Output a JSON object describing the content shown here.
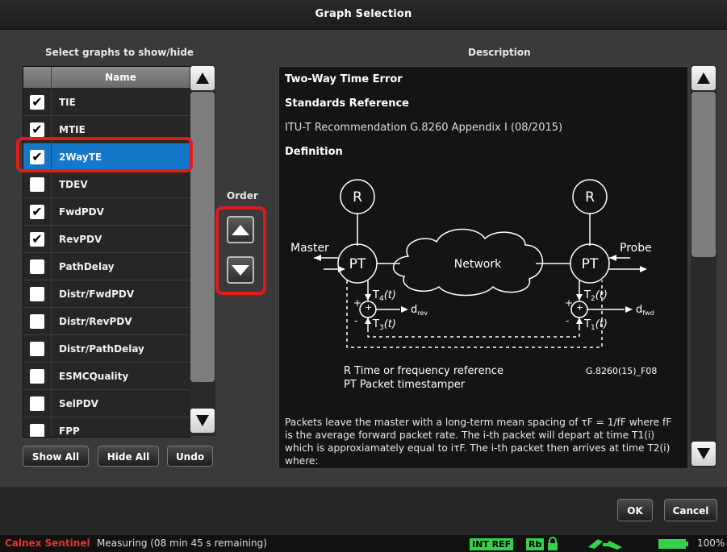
{
  "window": {
    "title": "Graph Selection"
  },
  "left_panel": {
    "title": "Select graphs to show/hide",
    "column_header": "Name",
    "items": [
      {
        "label": "TIE",
        "checked": true,
        "selected": false
      },
      {
        "label": "MTIE",
        "checked": true,
        "selected": false
      },
      {
        "label": "2WayTE",
        "checked": true,
        "selected": true
      },
      {
        "label": "TDEV",
        "checked": false,
        "selected": false
      },
      {
        "label": "FwdPDV",
        "checked": true,
        "selected": false
      },
      {
        "label": "RevPDV",
        "checked": true,
        "selected": false
      },
      {
        "label": "PathDelay",
        "checked": false,
        "selected": false
      },
      {
        "label": "Distr/FwdPDV",
        "checked": false,
        "selected": false
      },
      {
        "label": "Distr/RevPDV",
        "checked": false,
        "selected": false
      },
      {
        "label": "Distr/PathDelay",
        "checked": false,
        "selected": false
      },
      {
        "label": "ESMCQuality",
        "checked": false,
        "selected": false
      },
      {
        "label": "SelPDV",
        "checked": false,
        "selected": false
      },
      {
        "label": "FPP",
        "checked": false,
        "selected": false
      }
    ],
    "buttons": {
      "show_all": "Show All",
      "hide_all": "Hide All",
      "undo": "Undo"
    }
  },
  "order": {
    "label": "Order"
  },
  "description": {
    "title": "Description",
    "heading": "Two-Way Time Error",
    "standards_heading": "Standards Reference",
    "standards_text": "ITU-T Recommendation G.8260 Appendix I (08/2015)",
    "definition_heading": "Definition",
    "diagram": {
      "r_left": "R",
      "r_right": "R",
      "pt_left": "PT",
      "pt_right": "PT",
      "network": "Network",
      "master": "Master",
      "probe": "Probe",
      "t4": "T",
      "t4_sub": "4",
      "t_arg": "(t)",
      "t3": "T",
      "t3_sub": "3",
      "t2": "T",
      "t2_sub": "2",
      "t1": "T",
      "t1_sub": "1",
      "d_rev": "d",
      "d_rev_sub": "rev",
      "d_fwd": "d",
      "d_fwd_sub": "fwd",
      "plus": "+",
      "minus": "-",
      "legend_r": "R Time or frequency reference",
      "legend_pt": "PT Packet timestamper",
      "ref_code": "G.8260(15)_F08"
    },
    "paragraph": "Packets leave the master with a long-term mean spacing of τF = 1/fF where fF is the average forward packet rate. The i-th packet will depart at time T1(i) which is approxiamately equal to iτF. The i-th packet then arrives at time T2(i) where:"
  },
  "footer_buttons": {
    "ok": "OK",
    "cancel": "Cancel"
  },
  "status": {
    "brand": "Calnex Sentinel",
    "message": "Measuring (08 min 45 s remaining)",
    "int_ref": "INT REF",
    "rb": "Rb",
    "battery": "100%"
  },
  "colors": {
    "selected_row": "#1577c9",
    "highlight": "#e01b1b",
    "brand": "#e8342a",
    "status_green": "#35d14a"
  }
}
